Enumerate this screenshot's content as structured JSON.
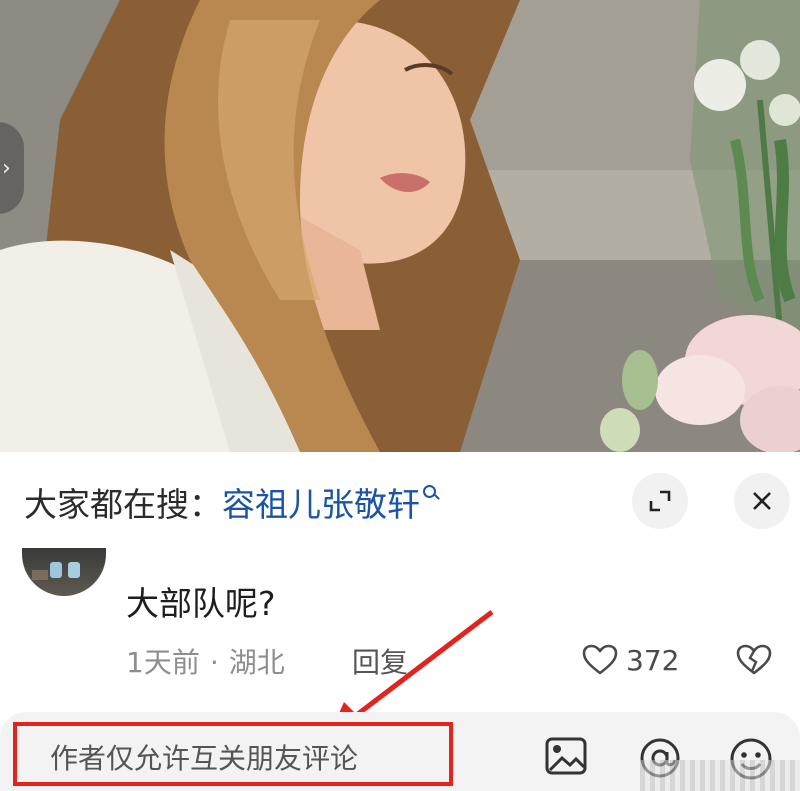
{
  "search_bar": {
    "prefix": "大家都在搜：",
    "term": "容祖儿张敬轩"
  },
  "comment": {
    "text": "大部队呢?",
    "time": "1天前",
    "separator": "·",
    "location": "湖北",
    "reply_label": "回复",
    "like_count": "372"
  },
  "input": {
    "placeholder": "作者仅允许互关朋友评论"
  },
  "icons": {
    "expand": "expand-icon",
    "close": "close-icon",
    "search": "search-icon",
    "like": "heart-outline-icon",
    "dislike": "broken-heart-icon",
    "image": "image-icon",
    "mention": "at-mention-icon",
    "emoji": "emoji-icon"
  },
  "colors": {
    "search_term": "#1a55a5",
    "annotation_red": "#e3231e"
  }
}
